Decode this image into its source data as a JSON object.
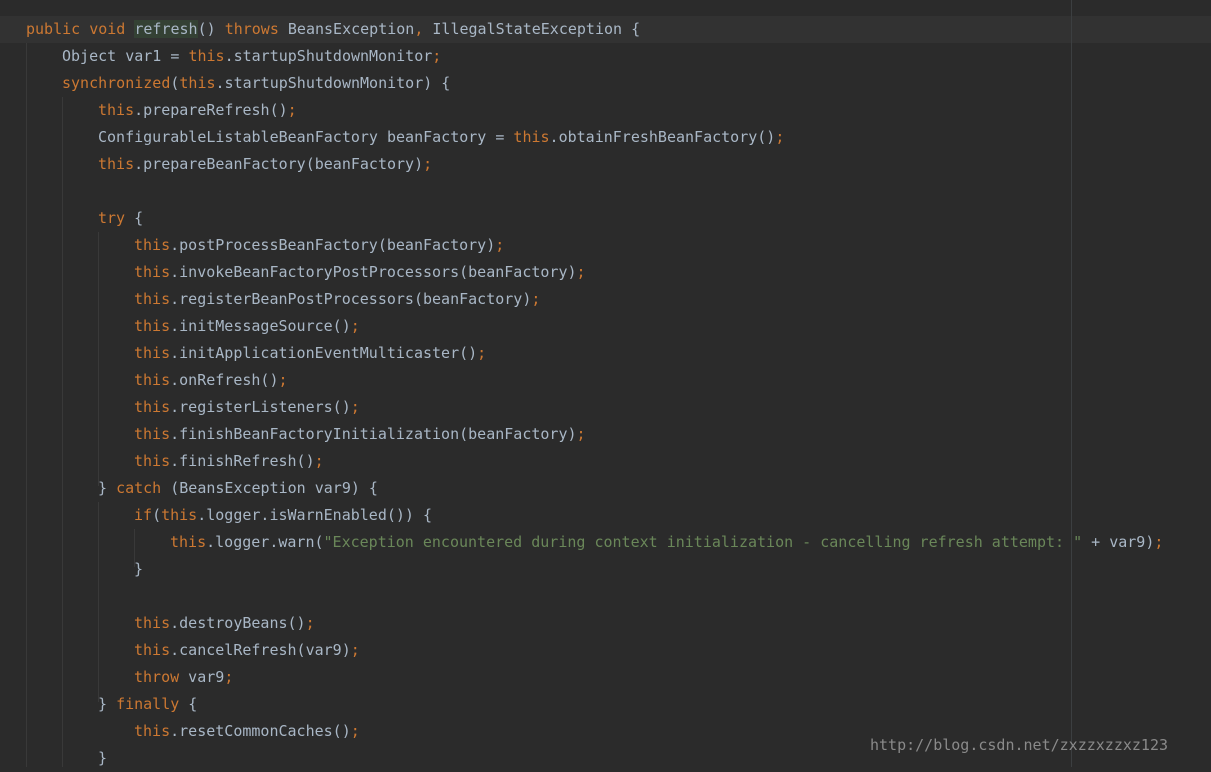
{
  "editor": {
    "language": "java",
    "colors": {
      "background": "#2b2b2b",
      "current_line": "#323232",
      "text": "#a9b7c6",
      "keyword": "#cc7832",
      "string": "#6a8759"
    },
    "lines": [
      {
        "indent": 0,
        "tokens": [
          {
            "t": "public",
            "c": "kw"
          },
          {
            "t": " "
          },
          {
            "t": "void",
            "c": "kw"
          },
          {
            "t": " "
          },
          {
            "t": "refresh",
            "c": "hl"
          },
          {
            "t": "() "
          },
          {
            "t": "throws",
            "c": "kw"
          },
          {
            "t": " BeansException"
          },
          {
            "t": ",",
            "c": "kw"
          },
          {
            "t": " IllegalStateException {"
          }
        ]
      },
      {
        "indent": 1,
        "tokens": [
          {
            "t": "Object var1 = "
          },
          {
            "t": "this",
            "c": "kw"
          },
          {
            "t": ".startupShutdownMonitor"
          },
          {
            "t": ";",
            "c": "kw"
          }
        ]
      },
      {
        "indent": 1,
        "tokens": [
          {
            "t": "synchronized",
            "c": "kw"
          },
          {
            "t": "("
          },
          {
            "t": "this",
            "c": "kw"
          },
          {
            "t": ".startupShutdownMonitor) {"
          }
        ]
      },
      {
        "indent": 2,
        "tokens": [
          {
            "t": "this",
            "c": "kw"
          },
          {
            "t": ".prepareRefresh()"
          },
          {
            "t": ";",
            "c": "kw"
          }
        ]
      },
      {
        "indent": 2,
        "tokens": [
          {
            "t": "ConfigurableListableBeanFactory beanFactory = "
          },
          {
            "t": "this",
            "c": "kw"
          },
          {
            "t": ".obtainFreshBeanFactory()"
          },
          {
            "t": ";",
            "c": "kw"
          }
        ]
      },
      {
        "indent": 2,
        "tokens": [
          {
            "t": "this",
            "c": "kw"
          },
          {
            "t": ".prepareBeanFactory(beanFactory)"
          },
          {
            "t": ";",
            "c": "kw"
          }
        ]
      },
      {
        "indent": 0,
        "tokens": []
      },
      {
        "indent": 2,
        "tokens": [
          {
            "t": "try",
            "c": "kw"
          },
          {
            "t": " {"
          }
        ]
      },
      {
        "indent": 3,
        "tokens": [
          {
            "t": "this",
            "c": "kw"
          },
          {
            "t": ".postProcessBeanFactory(beanFactory)"
          },
          {
            "t": ";",
            "c": "kw"
          }
        ]
      },
      {
        "indent": 3,
        "tokens": [
          {
            "t": "this",
            "c": "kw"
          },
          {
            "t": ".invokeBeanFactoryPostProcessors(beanFactory)"
          },
          {
            "t": ";",
            "c": "kw"
          }
        ]
      },
      {
        "indent": 3,
        "tokens": [
          {
            "t": "this",
            "c": "kw"
          },
          {
            "t": ".registerBeanPostProcessors(beanFactory)"
          },
          {
            "t": ";",
            "c": "kw"
          }
        ]
      },
      {
        "indent": 3,
        "tokens": [
          {
            "t": "this",
            "c": "kw"
          },
          {
            "t": ".initMessageSource()"
          },
          {
            "t": ";",
            "c": "kw"
          }
        ]
      },
      {
        "indent": 3,
        "tokens": [
          {
            "t": "this",
            "c": "kw"
          },
          {
            "t": ".initApplicationEventMulticaster()"
          },
          {
            "t": ";",
            "c": "kw"
          }
        ]
      },
      {
        "indent": 3,
        "tokens": [
          {
            "t": "this",
            "c": "kw"
          },
          {
            "t": ".onRefresh()"
          },
          {
            "t": ";",
            "c": "kw"
          }
        ]
      },
      {
        "indent": 3,
        "tokens": [
          {
            "t": "this",
            "c": "kw"
          },
          {
            "t": ".registerListeners()"
          },
          {
            "t": ";",
            "c": "kw"
          }
        ]
      },
      {
        "indent": 3,
        "tokens": [
          {
            "t": "this",
            "c": "kw"
          },
          {
            "t": ".finishBeanFactoryInitialization(beanFactory)"
          },
          {
            "t": ";",
            "c": "kw"
          }
        ]
      },
      {
        "indent": 3,
        "tokens": [
          {
            "t": "this",
            "c": "kw"
          },
          {
            "t": ".finishRefresh()"
          },
          {
            "t": ";",
            "c": "kw"
          }
        ]
      },
      {
        "indent": 2,
        "tokens": [
          {
            "t": "} "
          },
          {
            "t": "catch",
            "c": "kw"
          },
          {
            "t": " (BeansException var9) {"
          }
        ]
      },
      {
        "indent": 3,
        "tokens": [
          {
            "t": "if",
            "c": "kw"
          },
          {
            "t": "("
          },
          {
            "t": "this",
            "c": "kw"
          },
          {
            "t": ".logger.isWarnEnabled()) {"
          }
        ]
      },
      {
        "indent": 4,
        "tokens": [
          {
            "t": "this",
            "c": "kw"
          },
          {
            "t": ".logger.warn("
          },
          {
            "t": "\"Exception encountered during context initialization - cancelling refresh attempt: \"",
            "c": "str"
          },
          {
            "t": " + var9)"
          },
          {
            "t": ";",
            "c": "kw"
          }
        ]
      },
      {
        "indent": 3,
        "tokens": [
          {
            "t": "}"
          }
        ]
      },
      {
        "indent": 0,
        "tokens": []
      },
      {
        "indent": 3,
        "tokens": [
          {
            "t": "this",
            "c": "kw"
          },
          {
            "t": ".destroyBeans()"
          },
          {
            "t": ";",
            "c": "kw"
          }
        ]
      },
      {
        "indent": 3,
        "tokens": [
          {
            "t": "this",
            "c": "kw"
          },
          {
            "t": ".cancelRefresh(var9)"
          },
          {
            "t": ";",
            "c": "kw"
          }
        ]
      },
      {
        "indent": 3,
        "tokens": [
          {
            "t": "throw",
            "c": "kw"
          },
          {
            "t": " var9"
          },
          {
            "t": ";",
            "c": "kw"
          }
        ]
      },
      {
        "indent": 2,
        "tokens": [
          {
            "t": "} "
          },
          {
            "t": "finally",
            "c": "kw"
          },
          {
            "t": " {"
          }
        ]
      },
      {
        "indent": 3,
        "tokens": [
          {
            "t": "this",
            "c": "kw"
          },
          {
            "t": ".resetCommonCaches()"
          },
          {
            "t": ";",
            "c": "kw"
          }
        ]
      },
      {
        "indent": 2,
        "tokens": [
          {
            "t": "}"
          }
        ]
      }
    ]
  },
  "watermark": "http://blog.csdn.net/zxzzxzzxz123"
}
